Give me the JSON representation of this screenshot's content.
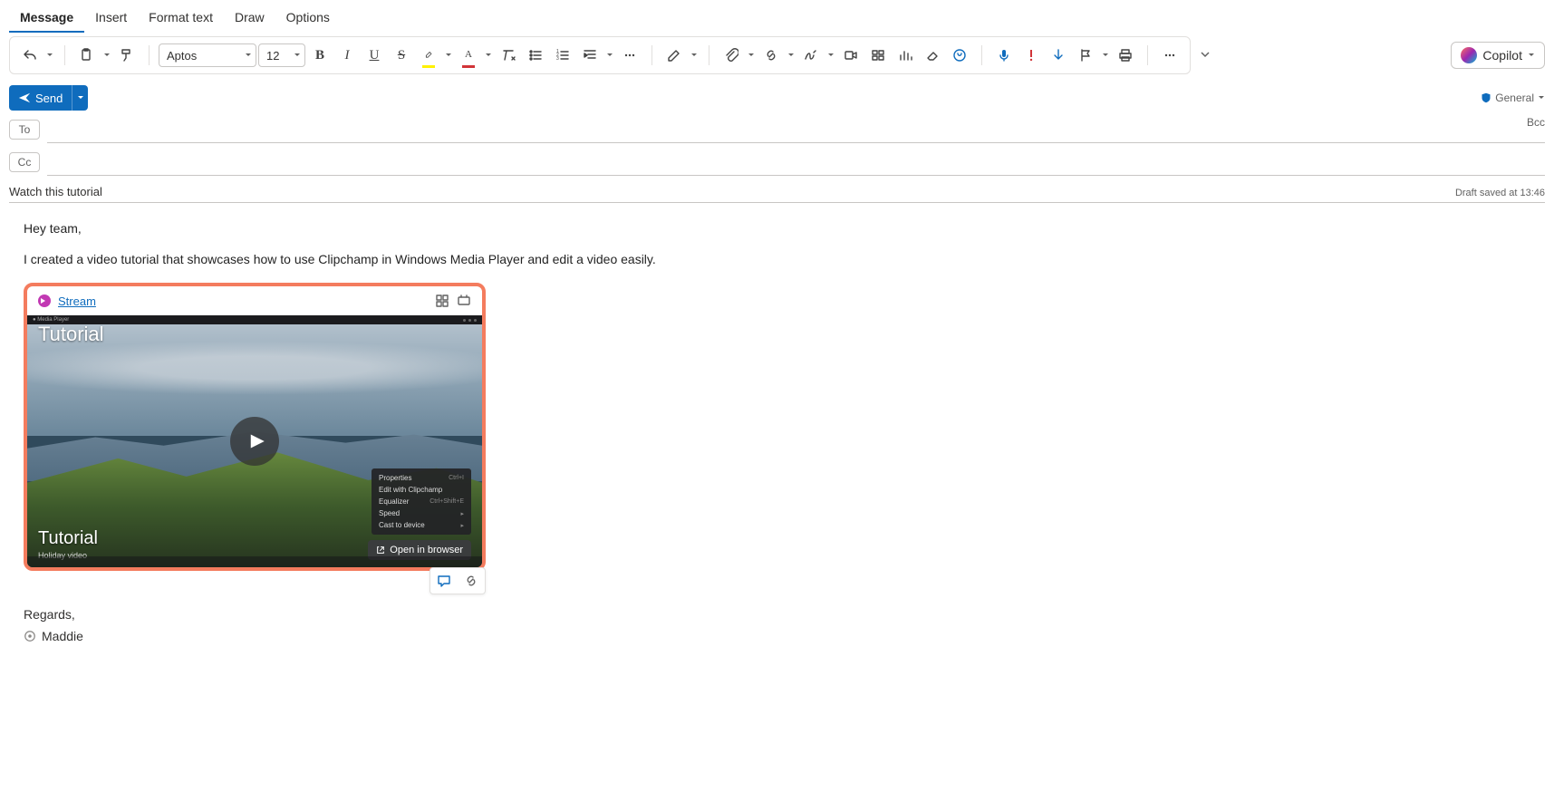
{
  "tabs": {
    "message": "Message",
    "insert": "Insert",
    "format": "Format text",
    "draw": "Draw",
    "options": "Options"
  },
  "ribbon": {
    "font_name": "Aptos",
    "font_size": "12",
    "copilot": "Copilot"
  },
  "send": {
    "label": "Send",
    "sensitivity": "General"
  },
  "header": {
    "to": "To",
    "cc": "Cc",
    "bcc": "Bcc"
  },
  "subject": "Watch this tutorial",
  "draft_status": "Draft saved at 13:46",
  "body": {
    "greeting": "Hey team,",
    "line1": "I created a video tutorial that showcases how to use Clipchamp in Windows Media Player and edit a video easily."
  },
  "card": {
    "source": "Stream",
    "title_top": "Tutorial",
    "title_bottom": "Tutorial",
    "subtitle": "Holiday video",
    "open_browser": "Open in browser",
    "context": {
      "properties": "Properties",
      "properties_key": "Ctrl+I",
      "edit": "Edit with Clipchamp",
      "equalizer": "Equalizer",
      "equalizer_key": "Ctrl+Shift+E",
      "speed": "Speed",
      "cast": "Cast to device"
    }
  },
  "signature": {
    "regards": "Regards,",
    "name": "Maddie"
  }
}
